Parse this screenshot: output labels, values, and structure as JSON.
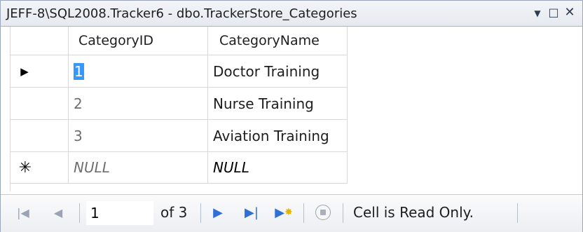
{
  "window": {
    "title": "JEFF-8\\SQL2008.Tracker6 - dbo.TrackerStore_Categories"
  },
  "grid": {
    "columns": [
      "CategoryID",
      "CategoryName"
    ],
    "rows": [
      {
        "indicator": "current-row",
        "CategoryID": "1",
        "CategoryName": "Doctor Training"
      },
      {
        "indicator": "",
        "CategoryID": "2",
        "CategoryName": "Nurse Training"
      },
      {
        "indicator": "",
        "CategoryID": "3",
        "CategoryName": "Aviation Training"
      }
    ],
    "new_row": {
      "indicator": "new-row",
      "CategoryID": "NULL",
      "CategoryName": "NULL"
    }
  },
  "navigator": {
    "current_record": "1",
    "of_text": "of 3",
    "status": "Cell is Read Only."
  },
  "icons": {
    "current_row": "row-pointer-icon",
    "new_row": "asterisk-icon",
    "first": "move-first-icon",
    "prev": "move-previous-icon",
    "next": "move-next-icon",
    "last": "move-last-icon",
    "new": "move-new-icon",
    "stop": "stop-icon"
  },
  "colors": {
    "selection": "#3399ff",
    "nav_blue": "#2f6fd6",
    "grid_lines": "#d8d8d8"
  }
}
